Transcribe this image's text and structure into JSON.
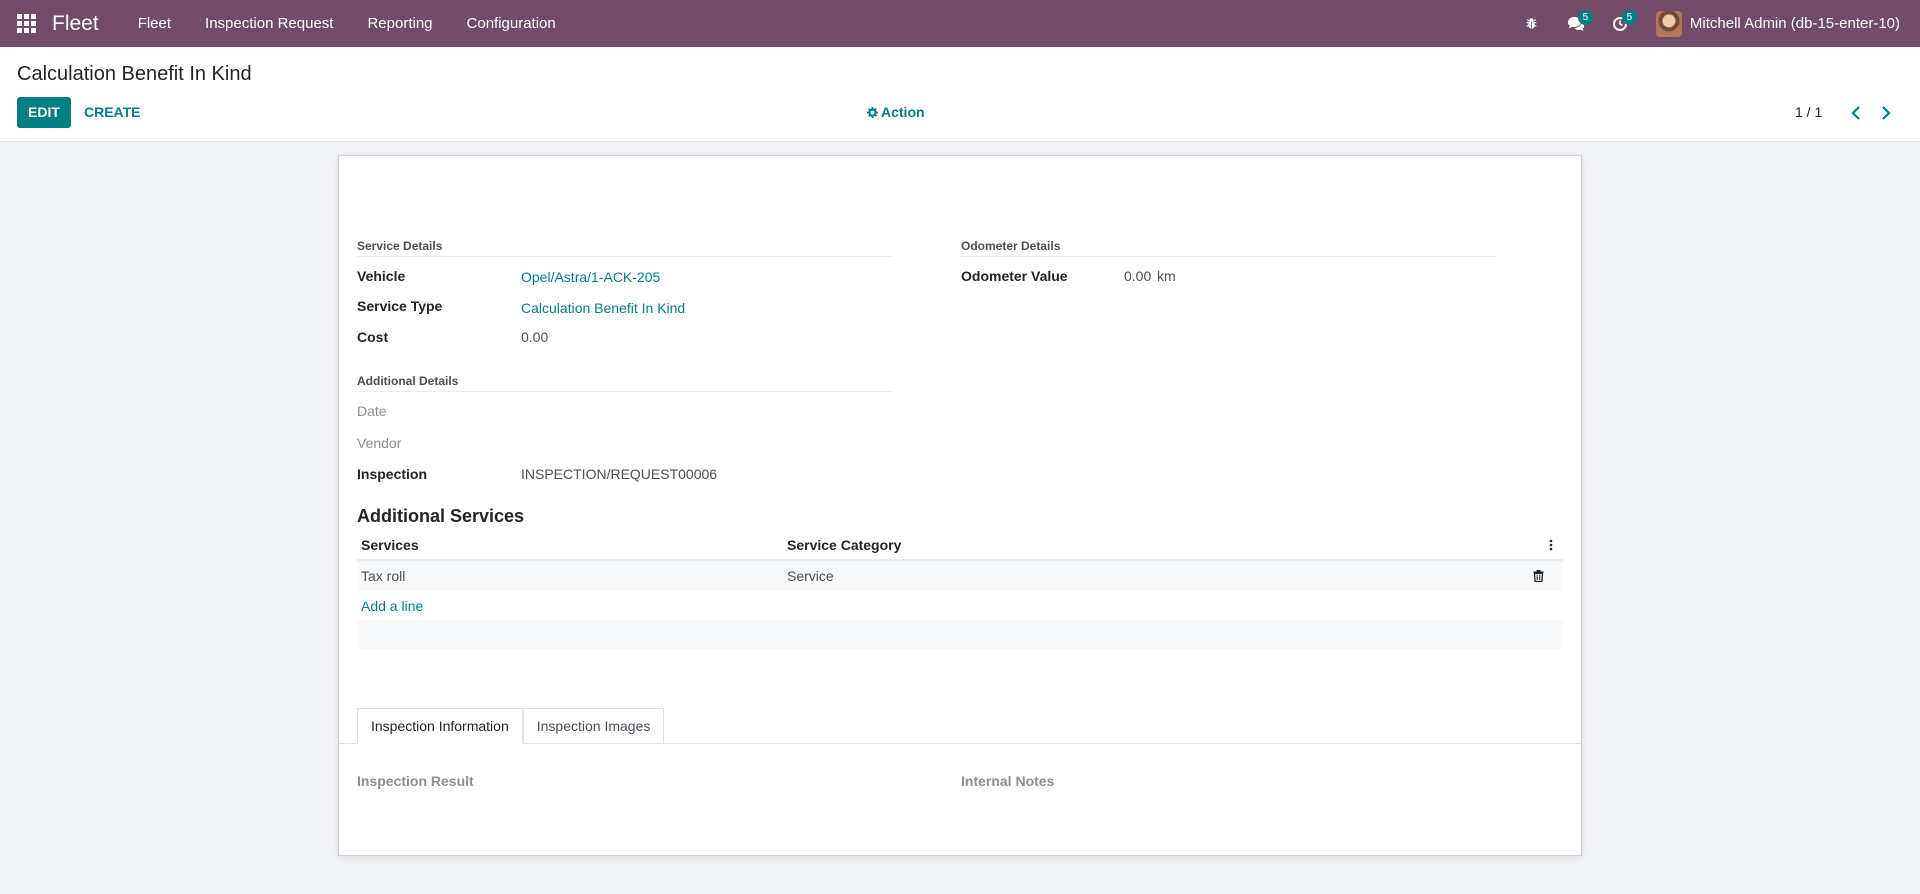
{
  "navbar": {
    "brand": "Fleet",
    "menu": [
      "Fleet",
      "Inspection Request",
      "Reporting",
      "Configuration"
    ],
    "messages_count": "5",
    "activities_count": "5",
    "user_name": "Mitchell Admin (db-15-enter-10)"
  },
  "control_panel": {
    "breadcrumb": "Calculation Benefit In Kind",
    "edit_label": "EDIT",
    "create_label": "CREATE",
    "action_label": "Action",
    "pager": "1 / 1"
  },
  "form": {
    "service_details": {
      "title": "Service Details",
      "vehicle_label": "Vehicle",
      "vehicle_value": "Opel/Astra/1-ACK-205",
      "service_type_label": "Service Type",
      "service_type_value": "Calculation Benefit In Kind",
      "cost_label": "Cost",
      "cost_value": "0.00"
    },
    "odometer_details": {
      "title": "Odometer Details",
      "odometer_label": "Odometer Value",
      "odometer_value": "0.00",
      "odometer_unit": "km"
    },
    "additional_details": {
      "title": "Additional Details",
      "date_label": "Date",
      "vendor_label": "Vendor",
      "inspection_label": "Inspection",
      "inspection_value": "INSPECTION/REQUEST00006"
    },
    "additional_services": {
      "title": "Additional Services",
      "columns": [
        "Services",
        "Service Category"
      ],
      "rows": [
        {
          "service": "Tax roll",
          "category": "Service"
        }
      ],
      "add_line": "Add a line"
    },
    "tabs": [
      "Inspection Information",
      "Inspection Images"
    ],
    "inspection_result_label": "Inspection Result",
    "internal_notes_label": "Internal Notes"
  }
}
